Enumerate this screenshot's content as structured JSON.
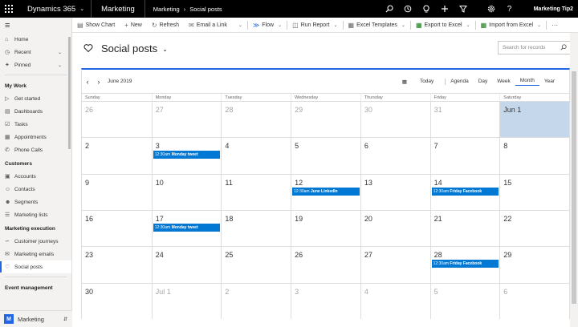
{
  "topbar": {
    "brand": "Dynamics 365",
    "app": "Marketing",
    "breadcrumb": [
      "Marketing",
      "Social posts"
    ],
    "user": "Marketing Tip2"
  },
  "toolbar": {
    "items": [
      {
        "label": "Show Chart",
        "icon": "chart-icon"
      },
      {
        "label": "New",
        "icon": "plus-icon"
      },
      {
        "label": "Refresh",
        "icon": "refresh-icon"
      },
      {
        "label": "Email a Link",
        "icon": "mail-icon"
      },
      {
        "label": "Flow",
        "icon": "flow-icon"
      },
      {
        "label": "Run Report",
        "icon": "report-icon"
      },
      {
        "label": "Excel Templates",
        "icon": "excel-templates-icon"
      },
      {
        "label": "Export to Excel",
        "icon": "excel-icon"
      },
      {
        "label": "Import from Excel",
        "icon": "excel-import-icon"
      }
    ]
  },
  "sidebar": {
    "top": [
      {
        "label": "Home"
      },
      {
        "label": "Recent"
      },
      {
        "label": "Pinned"
      }
    ],
    "sections": [
      {
        "title": "My Work",
        "items": [
          "Get started",
          "Dashboards",
          "Tasks",
          "Appointments",
          "Phone Calls"
        ]
      },
      {
        "title": "Customers",
        "items": [
          "Accounts",
          "Contacts",
          "Segments",
          "Marketing lists"
        ]
      },
      {
        "title": "Marketing execution",
        "items": [
          "Customer journeys",
          "Marketing emails",
          "Social posts"
        ]
      },
      {
        "title": "Event management",
        "items": []
      }
    ],
    "area": {
      "letter": "M",
      "label": "Marketing"
    }
  },
  "page": {
    "title": "Social posts",
    "search_placeholder": "Search for records"
  },
  "calendar": {
    "month_label": "June 2019",
    "today_label": "Today",
    "views": [
      "Agenda",
      "Day",
      "Week",
      "Month",
      "Year"
    ],
    "selected_view": "Month",
    "weekdays": [
      "Sunday",
      "Monday",
      "Tuesday",
      "Wednesday",
      "Thursday",
      "Friday",
      "Saturday"
    ],
    "weeks": [
      [
        "26",
        "27",
        "28",
        "29",
        "30",
        "31",
        "Jun 1"
      ],
      [
        "2",
        "3",
        "4",
        "5",
        "6",
        "7",
        "8"
      ],
      [
        "9",
        "10",
        "11",
        "12",
        "13",
        "14",
        "15"
      ],
      [
        "16",
        "17",
        "18",
        "19",
        "20",
        "21",
        "22"
      ],
      [
        "23",
        "24",
        "25",
        "26",
        "27",
        "28",
        "29"
      ],
      [
        "30",
        "Jul 1",
        "2",
        "3",
        "4",
        "5",
        "6"
      ]
    ],
    "events": [
      {
        "week": 1,
        "day": 1,
        "time": "12:30am",
        "title": "Monday tweet"
      },
      {
        "week": 2,
        "day": 3,
        "time": "12:30am",
        "title": "June LinkedIn"
      },
      {
        "week": 2,
        "day": 5,
        "time": "12:30am",
        "title": "Friday Facebook"
      },
      {
        "week": 3,
        "day": 1,
        "time": "12:30am",
        "title": "Monday tweet"
      },
      {
        "week": 4,
        "day": 5,
        "time": "12:30am",
        "title": "Friday Facebook"
      }
    ]
  }
}
